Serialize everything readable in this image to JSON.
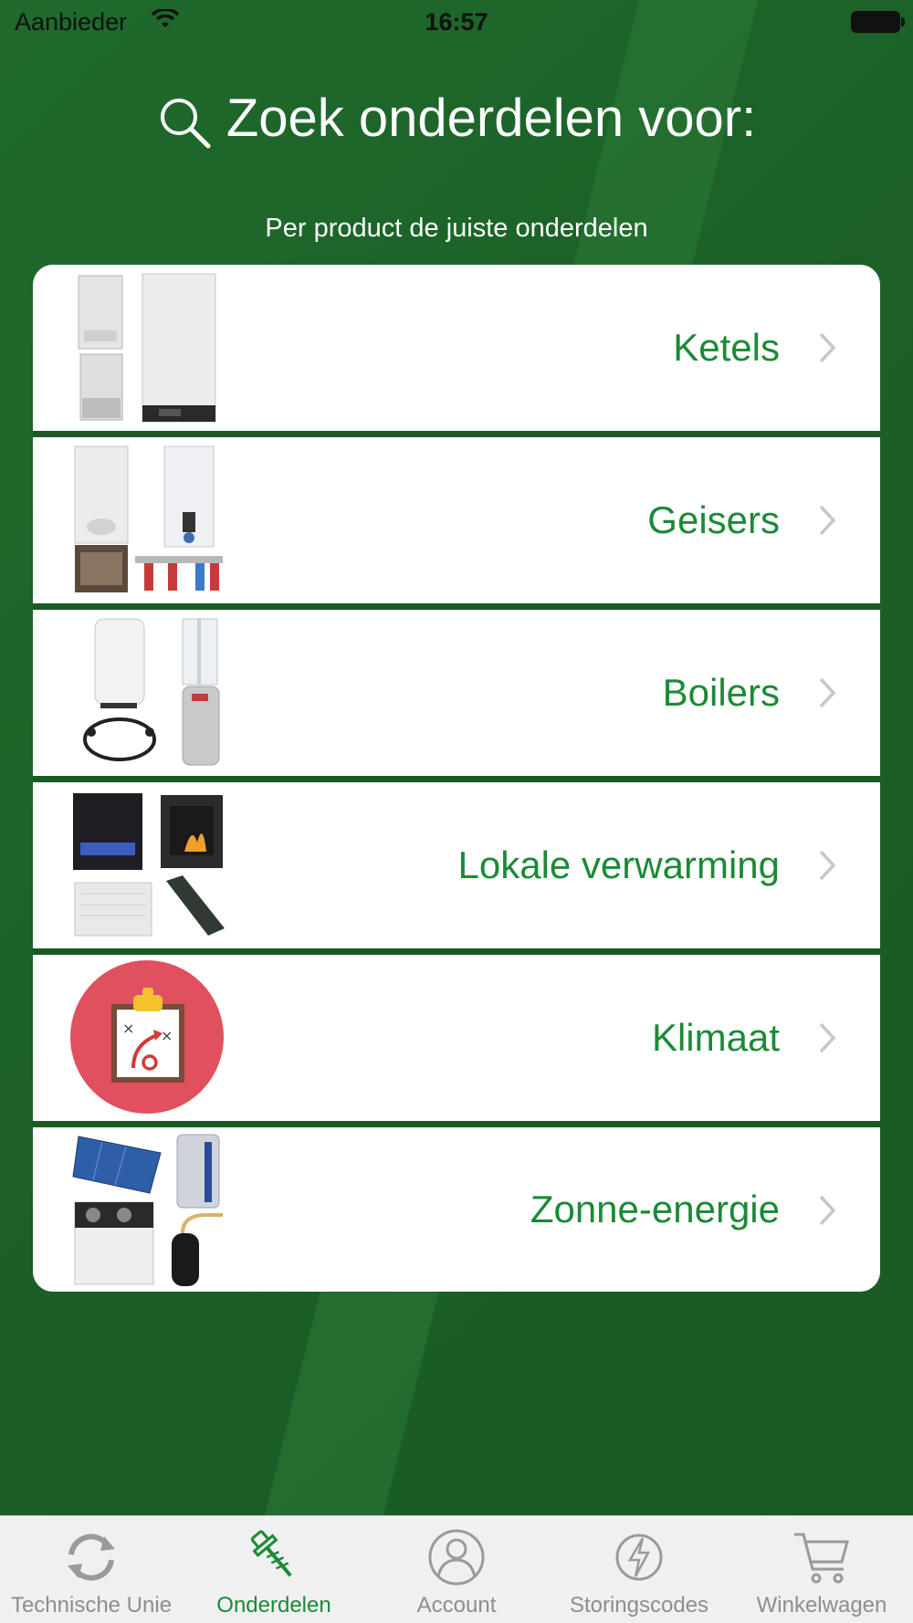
{
  "status_bar": {
    "carrier": "Aanbieder",
    "time": "16:57"
  },
  "header": {
    "title": "Zoek onderdelen voor:",
    "subtitle": "Per product de juiste onderdelen"
  },
  "categories": [
    {
      "label": "Ketels",
      "icon": "boiler-products-thumbnail"
    },
    {
      "label": "Geisers",
      "icon": "geyser-products-thumbnail"
    },
    {
      "label": "Boilers",
      "icon": "water-heater-products-thumbnail"
    },
    {
      "label": "Lokale verwarming",
      "icon": "local-heating-products-thumbnail"
    },
    {
      "label": "Klimaat",
      "icon": "clipboard-strategy-icon"
    },
    {
      "label": "Zonne-energie",
      "icon": "solar-energy-products-thumbnail"
    }
  ],
  "tab_bar": {
    "tabs": [
      {
        "label": "Technische Unie",
        "icon": "refresh-icon",
        "active": false
      },
      {
        "label": "Onderdelen",
        "icon": "screw-icon",
        "active": true
      },
      {
        "label": "Account",
        "icon": "user-icon",
        "active": false
      },
      {
        "label": "Storingscodes",
        "icon": "lightning-icon",
        "active": false
      },
      {
        "label": "Winkelwagen",
        "icon": "cart-icon",
        "active": false
      }
    ]
  },
  "colors": {
    "background": "#1b5e27",
    "accent": "#1b8a36",
    "tab_inactive": "#8e8e8e",
    "klimaat_circle": "#e0505f"
  }
}
